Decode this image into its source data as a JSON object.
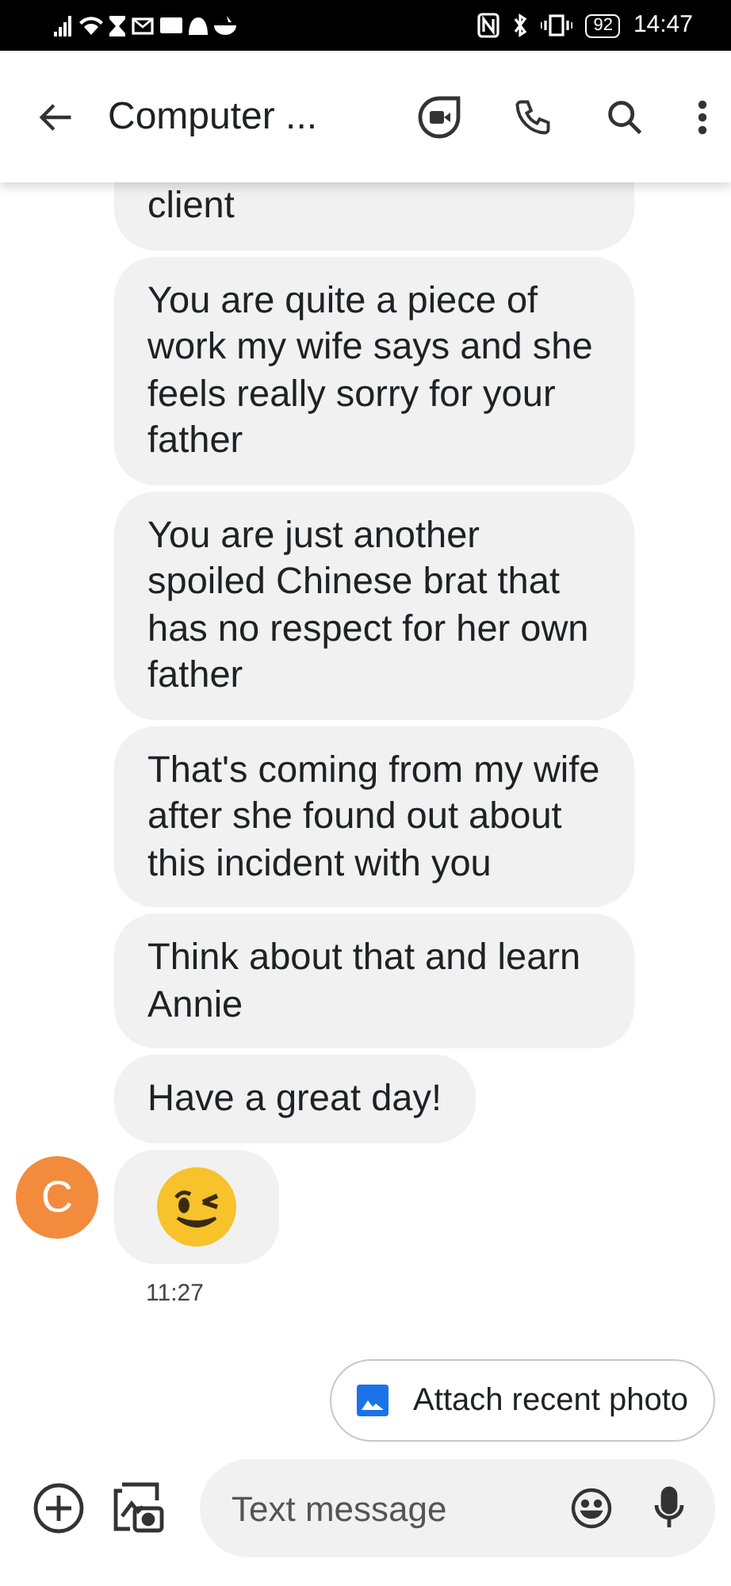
{
  "status_bar": {
    "battery": "92",
    "time": "14:47"
  },
  "header": {
    "title": "Computer ..."
  },
  "messages": [
    {
      "kind": "text",
      "text": "client"
    },
    {
      "kind": "text",
      "text": "You are quite a piece of work my wife says and she feels really sorry for your father"
    },
    {
      "kind": "text",
      "text": "You are just another spoiled Chinese brat that has no respect for her own father"
    },
    {
      "kind": "text",
      "text": "That's coming from my wife after she found out about this incident with you"
    },
    {
      "kind": "text",
      "text": "Think about that and learn Annie"
    },
    {
      "kind": "text",
      "text": "Have a great day!"
    },
    {
      "kind": "wink"
    }
  ],
  "sender": {
    "initial": "C",
    "color": "#f28b3c"
  },
  "timestamp": "11:27",
  "suggestion": {
    "label": "Attach recent photo"
  },
  "composer": {
    "placeholder": "Text message"
  }
}
